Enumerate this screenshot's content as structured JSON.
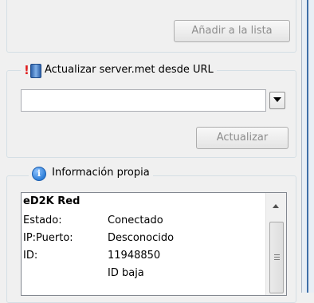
{
  "add_group": {
    "add_button_label": "Añadir a la lista"
  },
  "update_group": {
    "title": "Actualizar server.met desde URL",
    "url_value": "",
    "update_button_label": "Actualizar"
  },
  "info_group": {
    "title": "Información propia",
    "network_heading": "eD2K Red",
    "rows": [
      {
        "label": "Estado:",
        "value": "Conectado"
      },
      {
        "label": "IP:Puerto:",
        "value": "Desconocido"
      },
      {
        "label": "ID:",
        "value": "11948850"
      },
      {
        "label": "",
        "value": "ID baja"
      }
    ]
  },
  "colors": {
    "accent": "#3e6ea8",
    "info_icon": "#2f7fd8",
    "alert": "#e02020"
  }
}
